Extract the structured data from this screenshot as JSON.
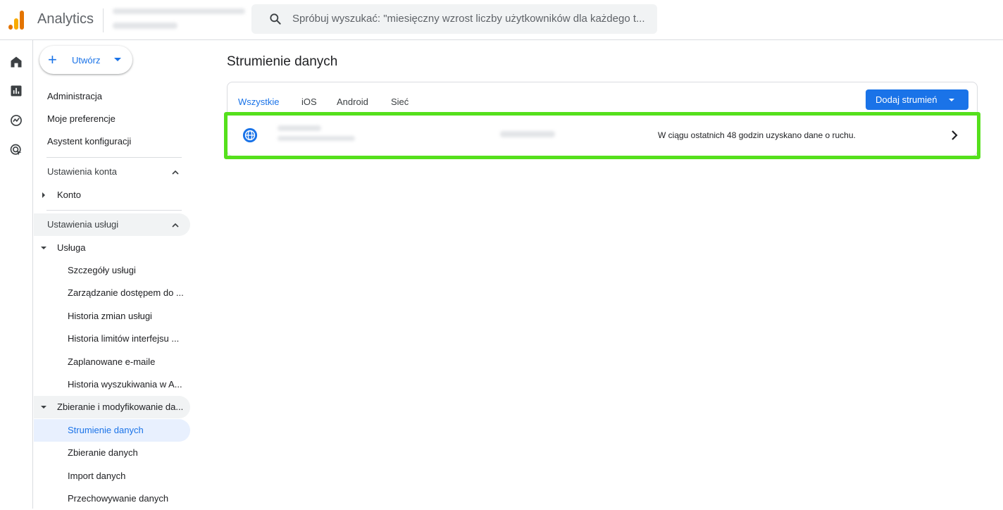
{
  "header": {
    "app_name": "Analytics",
    "search_placeholder": "Spróbuj wyszukać: \"miesięczny wzrost liczby użytkowników dla każdego t..."
  },
  "sidenav": {
    "create_label": "Utwórz",
    "top_items": [
      "Administracja",
      "Moje preferencje",
      "Asystent konfiguracji"
    ],
    "account_settings": {
      "label": "Ustawienia konta",
      "items": [
        "Konto"
      ]
    },
    "service_settings": {
      "label": "Ustawienia usługi",
      "service": {
        "label": "Usługa",
        "items": [
          "Szczegóły usługi",
          "Zarządzanie dostępem do ...",
          "Historia zmian usługi",
          "Historia limitów interfejsu ...",
          "Zaplanowane e-maile",
          "Historia wyszukiwania w A..."
        ]
      },
      "data_collection": {
        "label": "Zbieranie i modyfikowanie da...",
        "items": [
          "Strumienie danych",
          "Zbieranie danych",
          "Import danych",
          "Przechowywanie danych"
        ],
        "active": "Strumienie danych"
      }
    }
  },
  "main": {
    "title": "Strumienie danych",
    "tabs": [
      "Wszystkie",
      "iOS",
      "Android",
      "Sieć"
    ],
    "active_tab": "Wszystkie",
    "add_button": "Dodaj strumień",
    "streams": [
      {
        "icon": "globe-icon",
        "status": "W ciągu ostatnich 48 godzin uzyskano dane o ruchu."
      }
    ]
  },
  "colors": {
    "accent": "#1a73e8",
    "highlight": "#55e01c",
    "logo_orange": "#e37400",
    "logo_yellow": "#f9ab00"
  }
}
